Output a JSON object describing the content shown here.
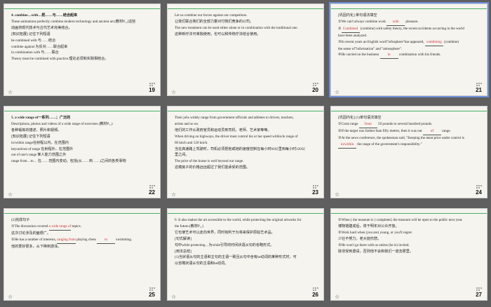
{
  "slides": [
    {
      "number": "19",
      "lines": [
        {
          "text": "4.  combine…with…把……与……结合起来",
          "cls": "b"
        },
        {
          "text": "These animations perfectly combine modern technology and ancient art.(教材P₁₁)这些"
        },
        {
          "text": "动画将现代技术与古代艺术完美结合。"
        },
        {
          "text": "[知识拓展]   记住下列短语"
        },
        {
          "text": "be combined with   与……结合"
        },
        {
          "text": "combine against  为反对……联合起来"
        },
        {
          "text": "in combination with  与……联合"
        },
        {
          "text": "Theory must be combined with practice.理论必须和实践相结合。"
        }
      ]
    },
    {
      "number": "20",
      "lines": [
        {
          "text": "Let us combine our forces against our competitors."
        },
        {
          "text": "让我们联合我们的全部力量对付我们竞争的公司。"
        },
        {
          "text": "The new treatment can be used either alone or in combination with the traditional one."
        },
        {
          "text": "这种新疗法可单独使用，也可以和传统疗法结合使用。"
        }
      ]
    },
    {
      "number": "21",
      "lines": [
        {
          "text": "[巩固内化]    单句语法填空"
        },
        {
          "text": "①We can't always combine work ___with___ pleasure."
        },
        {
          "text": "②___Combined___ (combine) with safety theory, the recent accidents occurring in the world"
        },
        {
          "text": "have been analyzed."
        },
        {
          "text": "③In recent years an English word\"infosphere\"has appeared, ___combining___ (combine)"
        },
        {
          "text": "the sense of\"information\" and \"atmosphere\"."
        },
        {
          "text": "④He carried on the business ___in___ combination with his friends."
        }
      ]
    },
    {
      "number": "22",
      "lines": [
        {
          "text": "5.  a wide range of一系列……；广泛的",
          "cls": "b"
        },
        {
          "text": "Descriptions, photos and videos of a wide range of exercises (教材P₁₁)"
        },
        {
          "text": "各种锻炼的描述、照片和视频。"
        },
        {
          "text": "[知识拓展]   记住下列短语"
        },
        {
          "text": "in/within range在射程以内，在范围内"
        },
        {
          "text": "beyond/out of range  在射程外，在范围外"
        },
        {
          "text": "out of one's range  某人能力范围之外"
        },
        {
          "text": "range from…to…  在……范围内变动，包括(从……到……)之间的各类事物"
        }
      ]
    },
    {
      "number": "23",
      "lines": [
        {
          "text": "Their jobs widely range from government officials and athletes to drivers, teachers,"
        },
        {
          "text": "artists and so on."
        },
        {
          "text": "他们的工作从政府官员和运动员到司机、老师、艺术家等等。"
        },
        {
          "text": "When driving on highways, the driver must control his or her speed within/in range of"
        },
        {
          "text": "60 km/h and 120 km/h."
        },
        {
          "text": "当在高速路上驾驶时，司机必须把他或她的速度控制在每小时60公里到每小时120公"
        },
        {
          "text": "里之间。"
        },
        {
          "text": "The price of the house is well beyond our range."
        },
        {
          "text": "这幢房子的价格远远超过了我们能承受的范围。"
        }
      ]
    },
    {
      "number": "24",
      "lines": [
        {
          "text": "[巩固内化]    (1)单句语法填空"
        },
        {
          "text": "①Costs range ___from___ 50 pounds to several hundred pounds."
        },
        {
          "text": "②If the target was farther than fifty metres, then it was out ___of___ range."
        },
        {
          "text": "③At the news conference, the spokesman said, \"Keeping the meat price under control is"
        },
        {
          "text": "___in/within___ the range of the government's responsibility.\""
        }
      ]
    },
    {
      "number": "25",
      "lines": [
        {
          "text": "(2)完成句子"
        },
        {
          "text": "①The discussion covered ___a wide range of___ topics."
        },
        {
          "text": "这次讨论涉及的面很广。"
        },
        {
          "text": "②He has a number of interests, ___ranging from___ playing chess ___to___ swimming."
        },
        {
          "text": "他的爱好很多，从下棋到游泳。"
        }
      ]
    },
    {
      "number": "26",
      "lines": [
        {
          "text": "6.  It also makes the art accessible to the world, while protecting the original artworks for"
        },
        {
          "text": "the future.(教材P₁₁)"
        },
        {
          "text": "它也使艺术可以走向世界，同时有利于为将来保护原始艺术品。"
        },
        {
          "text": "[句式解读]"
        },
        {
          "text": "句中while protecting…为while引导的时间状语从句的省略形式。"
        },
        {
          "text": "[用法总结]"
        },
        {
          "text": "(1)当状语从句的主语和主句的主语一致且从句中含有be动词的某种形式时，可"
        },
        {
          "text": "以省略状语从句的主语和be动词。"
        }
      ]
    },
    {
      "number": "27",
      "lines": [
        {
          "text": "①When ( the museum is ) completed, the museum will be open to the public next year."
        },
        {
          "text": "博物馆建成后，将于明年对公众开放。"
        },
        {
          "text": "②Work hard when (you are) young, or you'll regret."
        },
        {
          "text": "少壮不努力，老大徒伤悲。"
        },
        {
          "text": "③He won't go there with us unless (he is) invited."
        },
        {
          "text": "除非受到邀请，否则他不会和我们一道去那里。"
        }
      ]
    }
  ]
}
